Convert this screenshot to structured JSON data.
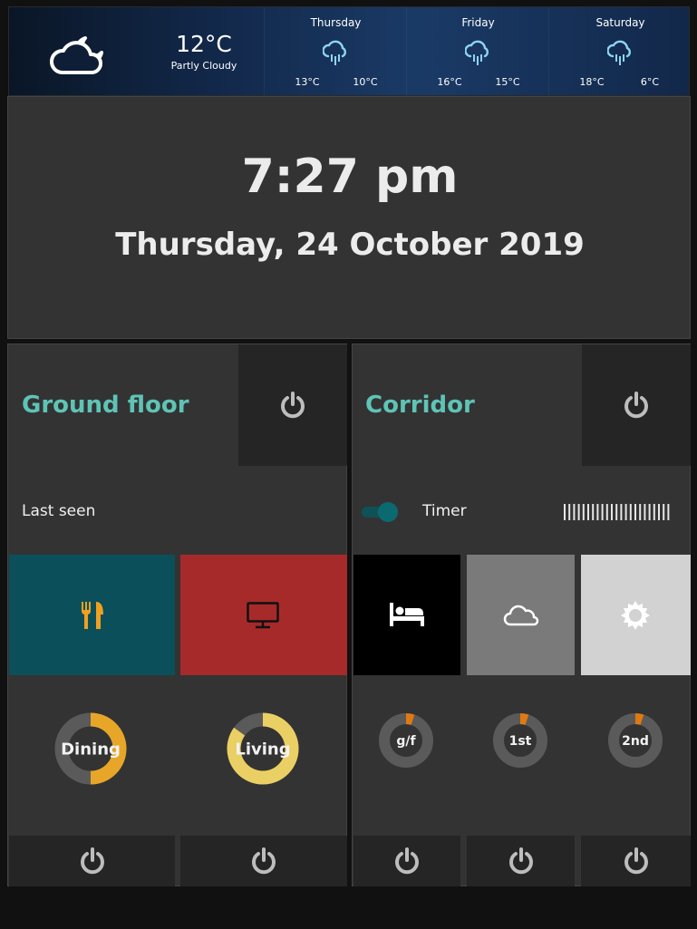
{
  "weather": {
    "current": {
      "icon": "partly-cloudy-night-icon",
      "temperature": "12°C",
      "condition": "Partly Cloudy"
    },
    "forecast": [
      {
        "day": "Thursday",
        "icon": "rain-icon",
        "high": "13°C",
        "low": "10°C"
      },
      {
        "day": "Friday",
        "icon": "rain-icon",
        "high": "16°C",
        "low": "15°C"
      },
      {
        "day": "Saturday",
        "icon": "rain-icon",
        "high": "18°C",
        "low": "6°C"
      }
    ]
  },
  "clock": {
    "time": "7:27 pm",
    "date": "Thursday, 24 October 2019"
  },
  "ground_floor": {
    "title": "Ground floor",
    "status_label": "Last seen",
    "tiles": [
      {
        "icon": "cutlery-icon",
        "color": "#0b4f5a",
        "icon_color": "#f0a020"
      },
      {
        "icon": "monitor-icon",
        "color": "#a62a2a",
        "icon_color": "#111111"
      }
    ],
    "gauges": [
      {
        "label": "Dining",
        "value": 0.5,
        "color": "#e8a628"
      },
      {
        "label": "Living",
        "value": 0.85,
        "color": "#ead064"
      }
    ]
  },
  "corridor": {
    "title": "Corridor",
    "timer_label": "Timer",
    "timer_on": true,
    "tiles": [
      {
        "icon": "bed-icon",
        "color": "#000000",
        "icon_color": "#ffffff"
      },
      {
        "icon": "cloud-icon",
        "color": "#7a7a7a",
        "icon_color": "#ffffff"
      },
      {
        "icon": "sun-icon",
        "color": "#d2d2d2",
        "icon_color": "#ffffff"
      }
    ],
    "gauges": [
      {
        "label": "g/f",
        "value": 0.05,
        "color": "#e07a10"
      },
      {
        "label": "1st",
        "value": 0.05,
        "color": "#e07a10"
      },
      {
        "label": "2nd",
        "value": 0.05,
        "color": "#e07a10"
      }
    ]
  },
  "colors": {
    "accent": "#5ec4b6",
    "panel": "#333333",
    "button": "#252525",
    "background": "#111111"
  }
}
